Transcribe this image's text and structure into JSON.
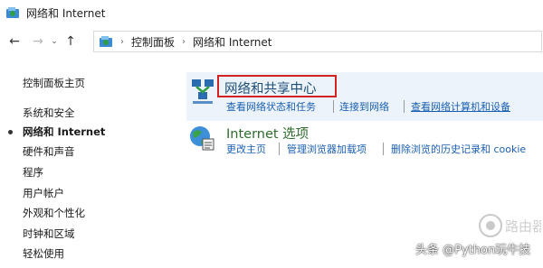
{
  "window": {
    "title": "网络和 Internet"
  },
  "navigation": {
    "back": "←",
    "forward": "→",
    "recent": "⌄",
    "up": "↑",
    "breadcrumb_sep": "›",
    "breadcrumbs": [
      "控制面板",
      "网络和 Internet"
    ]
  },
  "sidebar": {
    "items": [
      {
        "label": "控制面板主页"
      },
      {
        "label": "系统和安全"
      },
      {
        "label": "网络和 Internet",
        "active": true
      },
      {
        "label": "硬件和声音"
      },
      {
        "label": "程序"
      },
      {
        "label": "用户帐户"
      },
      {
        "label": "外观和个性化"
      },
      {
        "label": "时钟和区域"
      },
      {
        "label": "轻松使用"
      }
    ]
  },
  "categories": [
    {
      "title": "网络和共享中心",
      "links": [
        "查看网络状态和任务",
        "连接到网络",
        "查看网络计算机和设备"
      ]
    },
    {
      "title": "Internet 选项",
      "links": [
        "更改主页",
        "管理浏览器加载项",
        "删除浏览的历史记录和 cookie"
      ]
    }
  ],
  "watermark": {
    "text": "头条 @Python玩牛技",
    "logo_text": "路由器"
  },
  "colors": {
    "highlight": "#d32222",
    "link": "#1a5fb4",
    "band": "#ecf3fa"
  }
}
